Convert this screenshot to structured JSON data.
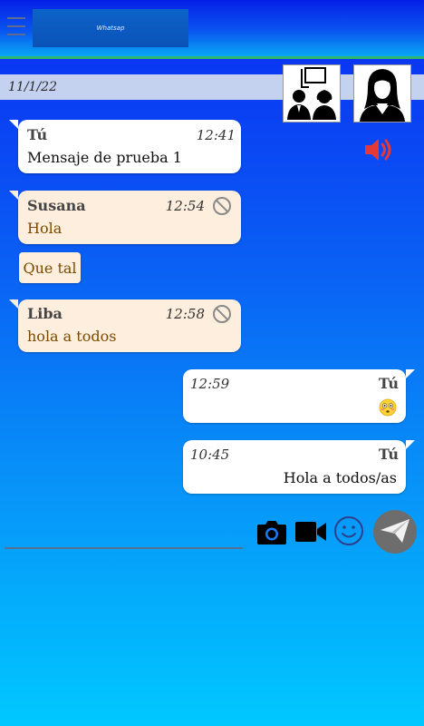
{
  "header": {
    "logo_text": "Whatsap",
    "menu_icon": "hamburger-menu-icon"
  },
  "date_separator": "11/1/22",
  "chat_header": {
    "group_avatar_icon": "group-chat-avatar-icon",
    "contact_avatar_icon": "woman-avatar-icon",
    "audio_icon": "speaker-volume-icon"
  },
  "messages": [
    {
      "sender": "Tú",
      "time": "12:41",
      "text": "Mensaje de prueba 1"
    },
    {
      "sender": "Susana",
      "time": "12:54",
      "text": "Hola"
    },
    {
      "text": "Que tal"
    },
    {
      "sender": "Liba",
      "time": "12:58",
      "text": "hola a todos"
    },
    {
      "sender": "Tú",
      "time": "12:59",
      "emoji": "flushed-face-emoji"
    },
    {
      "sender": "Tú",
      "time": "10:45",
      "text": "Hola a todos/as"
    }
  ],
  "composer": {
    "camera_icon": "camera-icon",
    "video_icon": "video-camera-icon",
    "emoji_icon": "smiley-icon",
    "send_icon": "paper-plane-send-icon"
  },
  "colors": {
    "incoming_peach": "#fdeedd",
    "outgoing_white": "#ffffff",
    "sender_brown_text": "#7a4a00",
    "speaker_red": "#e53935",
    "send_button_gray": "#6d6d6d",
    "header_accent_green": "#2db86e"
  }
}
